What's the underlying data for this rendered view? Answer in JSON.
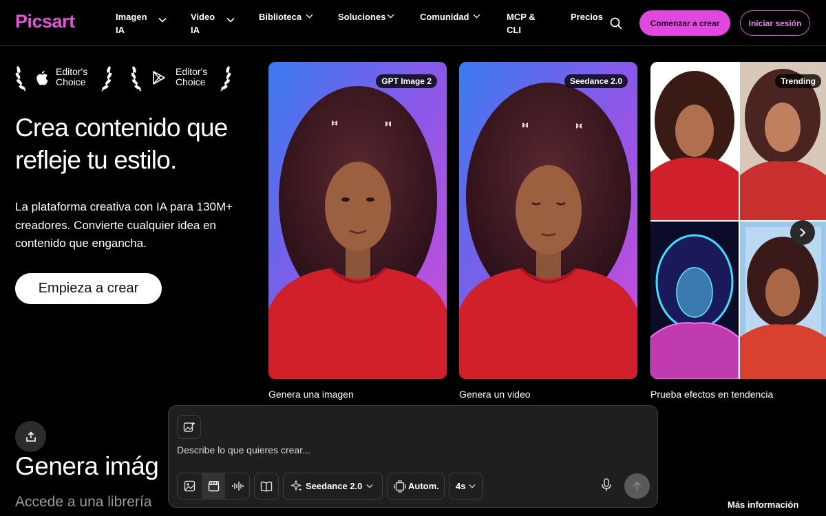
{
  "header": {
    "logo": "Picsart",
    "nav": [
      {
        "line1": "Imagen",
        "line2": "IA"
      },
      {
        "line1": "Video",
        "line2": "IA"
      },
      {
        "line1": "Biblioteca",
        "line2": ""
      },
      {
        "line1": "Soluciones",
        "line2": ""
      },
      {
        "line1": "Comunidad",
        "line2": ""
      },
      {
        "line1": "MCP &",
        "line2": "CLI"
      },
      {
        "line1": "Precios",
        "line2": ""
      }
    ],
    "start_label": "Comenzar a crear",
    "login_label": "Iniciar sesión"
  },
  "awards": [
    {
      "line1": "Editor's",
      "line2": "Choice",
      "icon": "apple-icon"
    },
    {
      "line1": "Editor's",
      "line2": "Choice",
      "icon": "google-play-icon"
    }
  ],
  "hero": {
    "title": "Crea contenido que refleje tu estilo.",
    "subtitle": "La plataforma creativa con IA para 130M+ creadores. Convierte cualquier idea en contenido que engancha.",
    "cta": "Empieza a crear"
  },
  "cards": [
    {
      "badge": "GPT Image 2",
      "label": "Genera una imagen"
    },
    {
      "badge": "Seedance 2.0",
      "label": "Genera un video"
    },
    {
      "badge": "Trending",
      "label": "Prueba efectos en tendencia"
    }
  ],
  "section": {
    "title": "Genera imág",
    "subtitle": "Accede a una librería",
    "more_info": "Más información"
  },
  "prompt_panel": {
    "placeholder": "Describe lo que quieres crear...",
    "model": "Seedance 2.0",
    "ratio": "Autom.",
    "duration": "4s"
  },
  "colors": {
    "brand": "#e255d8",
    "cta_bg": "#e148e0"
  }
}
